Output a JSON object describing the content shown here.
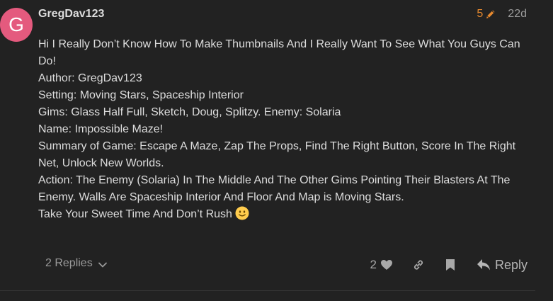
{
  "post": {
    "avatar_letter": "G",
    "avatar_color": "#e45a7e",
    "username": "GregDav123",
    "edit_count": "5",
    "age": "22d",
    "lines": [
      "Hi I Really Don’t Know How To Make Thumbnails And I Really Want To See What You Guys Can Do!",
      "Author: GregDav123",
      "Setting: Moving Stars, Spaceship Interior",
      "Gims: Glass Half Full, Sketch, Doug, Splitzy. Enemy: Solaria",
      "Name: Impossible Maze!",
      "Summary of Game: Escape A Maze, Zap The Props, Find The Right Button, Score In The Right Net, Unlock New Worlds.",
      "Action: The Enemy (Solaria) In The Middle And The Other Gims Pointing Their Blasters At The Enemy. Walls Are Spaceship Interior And Floor And Map is Moving Stars.",
      "Take Your Sweet Time And Don’t Rush"
    ],
    "closing_emoji": "slightly-smiling-face"
  },
  "footer": {
    "replies_label": "2 Replies",
    "like_count": "2",
    "reply_label": "Reply"
  },
  "icons": {
    "edit": "pencil-icon",
    "replies_toggle": "chevron-down-icon",
    "like": "heart-icon",
    "share": "link-icon",
    "bookmark": "bookmark-icon",
    "reply": "reply-arrow-icon"
  },
  "colors": {
    "background": "#222222",
    "text": "#dddddd",
    "edit_accent": "#e6892e",
    "muted": "#9a9a9a"
  }
}
